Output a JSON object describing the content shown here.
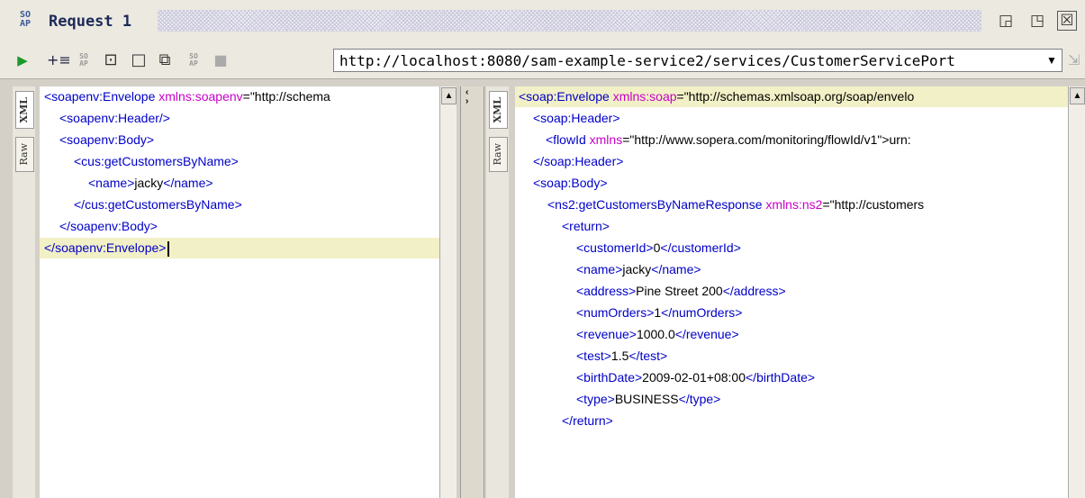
{
  "window": {
    "title": "Request 1",
    "logo_text": "SO\nAP"
  },
  "window_buttons": [
    "◲",
    "◳",
    "☒"
  ],
  "toolbar": {
    "url": "http://localhost:8080/sam-example-service2/services/CustomerServicePort",
    "soap_label": "SO\nAP"
  },
  "request_pane": {
    "tabs": [
      "XML",
      "Raw"
    ],
    "lines": [
      [
        {
          "t": "tag",
          "v": "<soapenv:Envelope "
        },
        {
          "t": "attr",
          "v": "xmlns:soapenv"
        },
        {
          "t": "txt",
          "v": "=\"http://schema"
        }
      ],
      [
        {
          "t": "tag",
          "v": "<soapenv:Header/>"
        }
      ],
      [
        {
          "t": "tag",
          "v": "<soapenv:Body>"
        }
      ],
      [
        {
          "t": "tag",
          "v": "<cus:getCustomersByName>"
        }
      ],
      [
        {
          "t": "tag",
          "v": "<name>"
        },
        {
          "t": "txt",
          "v": "jacky"
        },
        {
          "t": "tag",
          "v": "</name>"
        }
      ],
      [
        {
          "t": "tag",
          "v": "</cus:getCustomersByName>"
        }
      ],
      [
        {
          "t": "tag",
          "v": "</soapenv:Body>"
        }
      ],
      [
        {
          "t": "tag",
          "v": "</soapenv:Envelope>"
        }
      ]
    ]
  },
  "response_pane": {
    "tabs": [
      "XML",
      "Raw"
    ],
    "lines": [
      [
        {
          "t": "tag",
          "v": "<soap:Envelope "
        },
        {
          "t": "attr",
          "v": "xmlns:soap"
        },
        {
          "t": "txt",
          "v": "=\"http://schemas.xmlsoap.org/soap/envelo"
        }
      ],
      [
        {
          "t": "tag",
          "v": "<soap:Header>"
        }
      ],
      [
        {
          "t": "tag",
          "v": "<flowId "
        },
        {
          "t": "attr",
          "v": "xmlns"
        },
        {
          "t": "txt",
          "v": "=\"http://www.sopera.com/monitoring/flowId/v1\">urn:"
        }
      ],
      [
        {
          "t": "tag",
          "v": "</soap:Header>"
        }
      ],
      [
        {
          "t": "tag",
          "v": "<soap:Body>"
        }
      ],
      [
        {
          "t": "tag",
          "v": "<ns2:getCustomersByNameResponse "
        },
        {
          "t": "attr",
          "v": "xmlns:ns2"
        },
        {
          "t": "txt",
          "v": "=\"http://customers"
        }
      ],
      [
        {
          "t": "tag",
          "v": "<return>"
        }
      ],
      [
        {
          "t": "tag",
          "v": "<customerId>"
        },
        {
          "t": "txt",
          "v": "0"
        },
        {
          "t": "tag",
          "v": "</customerId>"
        }
      ],
      [
        {
          "t": "tag",
          "v": "<name>"
        },
        {
          "t": "txt",
          "v": "jacky"
        },
        {
          "t": "tag",
          "v": "</name>"
        }
      ],
      [
        {
          "t": "tag",
          "v": "<address>"
        },
        {
          "t": "txt",
          "v": "Pine Street 200"
        },
        {
          "t": "tag",
          "v": "</address>"
        }
      ],
      [
        {
          "t": "tag",
          "v": "<numOrders>"
        },
        {
          "t": "txt",
          "v": "1"
        },
        {
          "t": "tag",
          "v": "</numOrders>"
        }
      ],
      [
        {
          "t": "tag",
          "v": "<revenue>"
        },
        {
          "t": "txt",
          "v": "1000.0"
        },
        {
          "t": "tag",
          "v": "</revenue>"
        }
      ],
      [
        {
          "t": "tag",
          "v": "<test>"
        },
        {
          "t": "txt",
          "v": "1.5"
        },
        {
          "t": "tag",
          "v": "</test>"
        }
      ],
      [
        {
          "t": "tag",
          "v": "<birthDate>"
        },
        {
          "t": "txt",
          "v": "2009-02-01+08:00"
        },
        {
          "t": "tag",
          "v": "</birthDate>"
        }
      ],
      [
        {
          "t": "tag",
          "v": "<type>"
        },
        {
          "t": "txt",
          "v": "BUSINESS"
        },
        {
          "t": "tag",
          "v": "</type>"
        }
      ],
      [
        {
          "t": "tag",
          "v": "</return>"
        }
      ]
    ]
  }
}
